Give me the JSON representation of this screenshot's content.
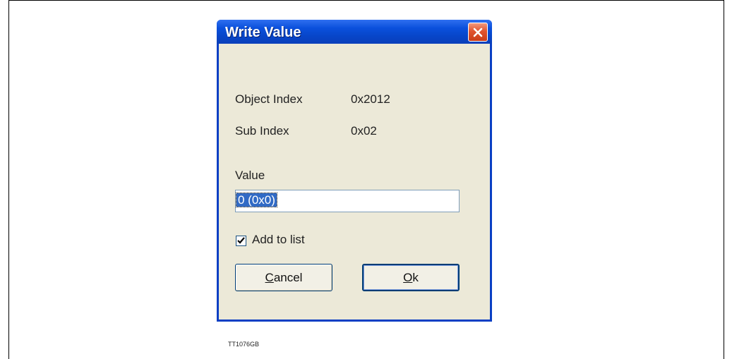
{
  "dialog": {
    "title": "Write Value",
    "object_index_label": "Object Index",
    "object_index_value": "0x2012",
    "sub_index_label": "Sub Index",
    "sub_index_value": "0x02",
    "value_label": "Value",
    "value_input": "0 (0x0)",
    "add_to_list_label": "Add to list",
    "add_to_list_checked": true,
    "cancel_prefix": "C",
    "cancel_rest": "ancel",
    "ok_prefix": "O",
    "ok_rest": "k"
  },
  "figure_tag": "TT1076GB",
  "colors": {
    "title_bar": "#0a50dc",
    "dialog_bg": "#ece9d8",
    "close_button": "#e0532e",
    "selection": "#316ac5"
  }
}
